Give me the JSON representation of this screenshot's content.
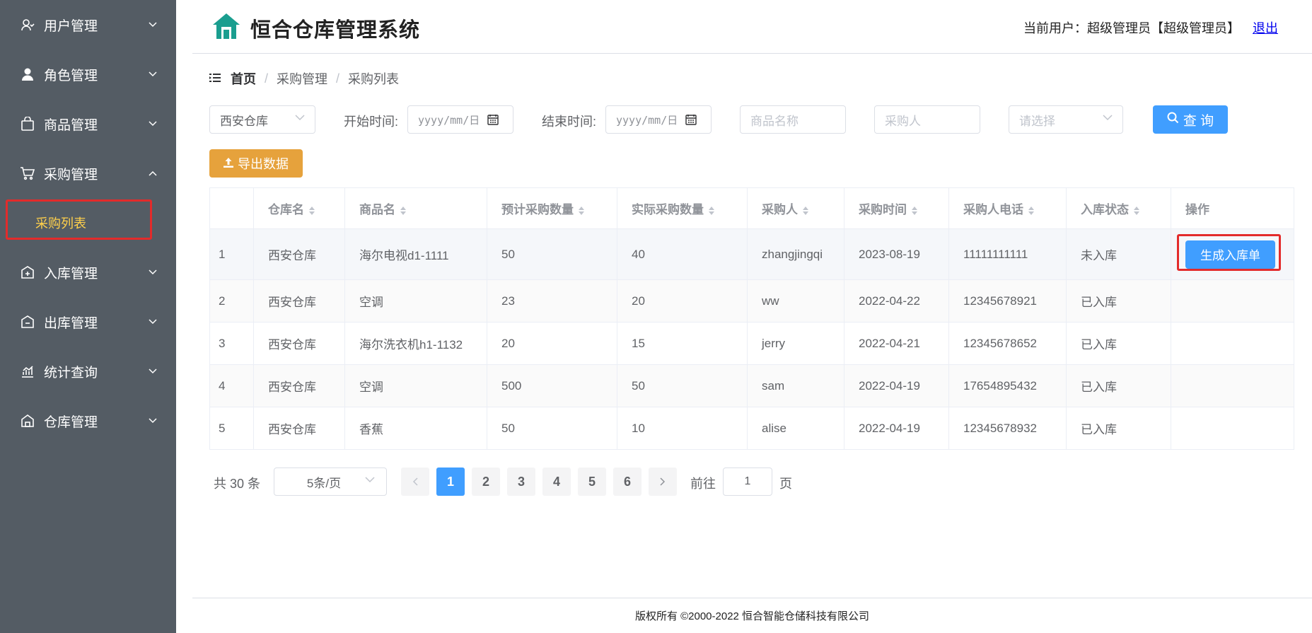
{
  "sidebar": {
    "items": [
      {
        "label": "用户管理",
        "icon": "user-icon"
      },
      {
        "label": "角色管理",
        "icon": "person-icon"
      },
      {
        "label": "商品管理",
        "icon": "bag-icon"
      },
      {
        "label": "采购管理",
        "icon": "cart-icon",
        "expanded": true
      },
      {
        "label": "入库管理",
        "icon": "inbound-icon"
      },
      {
        "label": "出库管理",
        "icon": "outbound-icon"
      },
      {
        "label": "统计查询",
        "icon": "chart-icon"
      },
      {
        "label": "仓库管理",
        "icon": "warehouse-icon"
      }
    ],
    "sub_item": "采购列表",
    "active_color": "#ffd04b",
    "bg_color": "#545c64"
  },
  "header": {
    "title": "恒合仓库管理系统",
    "user_label": "当前用户：超级管理员【超级管理员】",
    "logout": "退出"
  },
  "breadcrumb": {
    "home": "首页",
    "level2": "采购管理",
    "level3": "采购列表"
  },
  "filters": {
    "warehouse": "西安仓库",
    "start_label": "开始时间:",
    "start_placeholder": "yyyy/mm/日",
    "end_label": "结束时间:",
    "end_placeholder": "yyyy/mm/日",
    "product_placeholder": "商品名称",
    "buyer_placeholder": "采购人",
    "select_placeholder": "请选择",
    "query_button": "查 询",
    "export_button": "导出数据"
  },
  "table": {
    "headers": [
      "仓库名",
      "商品名",
      "预计采购数量",
      "实际采购数量",
      "采购人",
      "采购时间",
      "采购人电话",
      "入库状态",
      "操作"
    ],
    "rows": [
      {
        "idx": "1",
        "warehouse": "西安仓库",
        "product": "海尔电视d1-1111",
        "planned": "50",
        "actual": "40",
        "buyer": "zhangjingqi",
        "date": "2023-08-19",
        "phone": "11111111111",
        "status": "未入库",
        "action": "生成入库单"
      },
      {
        "idx": "2",
        "warehouse": "西安仓库",
        "product": "空调",
        "planned": "23",
        "actual": "20",
        "buyer": "ww",
        "date": "2022-04-22",
        "phone": "12345678921",
        "status": "已入库",
        "action": ""
      },
      {
        "idx": "3",
        "warehouse": "西安仓库",
        "product": "海尔洗衣机h1-1132",
        "planned": "20",
        "actual": "15",
        "buyer": "jerry",
        "date": "2022-04-21",
        "phone": "12345678652",
        "status": "已入库",
        "action": ""
      },
      {
        "idx": "4",
        "warehouse": "西安仓库",
        "product": "空调",
        "planned": "500",
        "actual": "50",
        "buyer": "sam",
        "date": "2022-04-19",
        "phone": "17654895432",
        "status": "已入库",
        "action": ""
      },
      {
        "idx": "5",
        "warehouse": "西安仓库",
        "product": "香蕉",
        "planned": "50",
        "actual": "10",
        "buyer": "alise",
        "date": "2022-04-19",
        "phone": "12345678932",
        "status": "已入库",
        "action": ""
      }
    ]
  },
  "pagination": {
    "total": "共 30 条",
    "page_size": "5条/页",
    "pages": [
      "1",
      "2",
      "3",
      "4",
      "5",
      "6"
    ],
    "current": "1",
    "goto_label": "前往",
    "goto_value": "1",
    "page_suffix": "页"
  },
  "footer": {
    "text": "版权所有 ©2000-2022  恒合智能仓储科技有限公司"
  },
  "colors": {
    "primary": "#409eff",
    "warning": "#e6a23c",
    "highlight_box": "#e32b2b",
    "status_pending": "#ff0000",
    "status_done": "#008000"
  }
}
